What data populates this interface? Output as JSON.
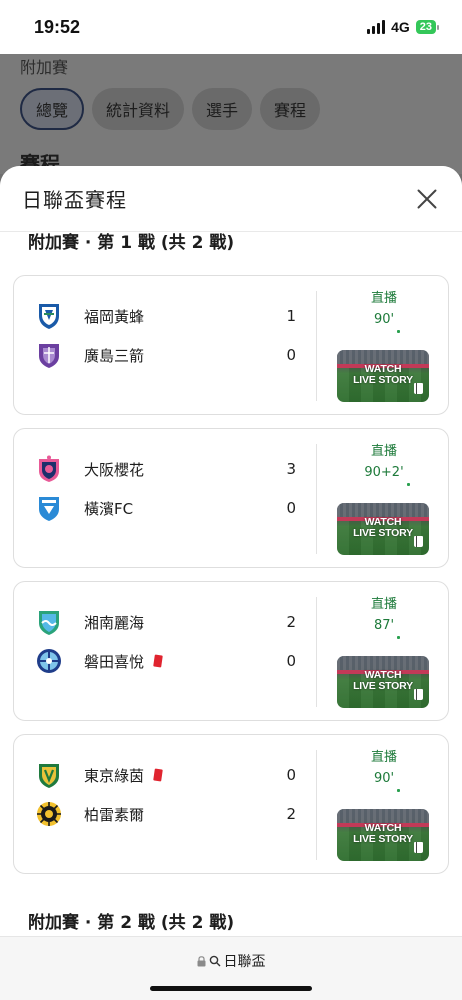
{
  "status_bar": {
    "time": "19:52",
    "network": "4G",
    "battery": "23"
  },
  "background_page": {
    "section_label": "附加賽",
    "tabs": [
      {
        "label": "總覽",
        "active": true
      },
      {
        "label": "統計資料",
        "active": false
      },
      {
        "label": "選手",
        "active": false
      },
      {
        "label": "賽程",
        "active": false
      }
    ],
    "heading": "賽程"
  },
  "sheet": {
    "title": "日聯盃賽程",
    "round1_title": "附加賽 · 第 1 戰 (共 2 戰)",
    "round2_title": "附加賽 · 第 2 戰 (共 2 戰)",
    "video_label_line1": "WATCH",
    "video_label_line2": "LIVE STORY",
    "matches": [
      {
        "home": {
          "name": "福岡黃蜂",
          "score": "1",
          "red_card": false,
          "logo": "avispa-fukuoka-crest"
        },
        "away": {
          "name": "廣島三箭",
          "score": "0",
          "red_card": false,
          "logo": "sanfrecce-hiroshima-crest"
        },
        "status": "直播",
        "minute": "90'"
      },
      {
        "home": {
          "name": "大阪櫻花",
          "score": "3",
          "red_card": false,
          "logo": "cerezo-osaka-crest"
        },
        "away": {
          "name": "橫濱FC",
          "score": "0",
          "red_card": false,
          "logo": "yokohama-fc-crest"
        },
        "status": "直播",
        "minute": "90+2'"
      },
      {
        "home": {
          "name": "湘南麗海",
          "score": "2",
          "red_card": false,
          "logo": "shonan-bellmare-crest"
        },
        "away": {
          "name": "磐田喜悅",
          "score": "0",
          "red_card": true,
          "logo": "jubilo-iwata-crest"
        },
        "status": "直播",
        "minute": "87'"
      },
      {
        "home": {
          "name": "東京綠茵",
          "score": "0",
          "red_card": true,
          "logo": "tokyo-verdy-crest"
        },
        "away": {
          "name": "柏雷素爾",
          "score": "2",
          "red_card": false,
          "logo": "kashiwa-reysol-crest"
        },
        "status": "直播",
        "minute": "90'"
      }
    ]
  },
  "bottom_bar": {
    "url_text": "日聯盃"
  },
  "colors": {
    "live_green": "#1d7a3a",
    "red_card": "#e0242f"
  }
}
